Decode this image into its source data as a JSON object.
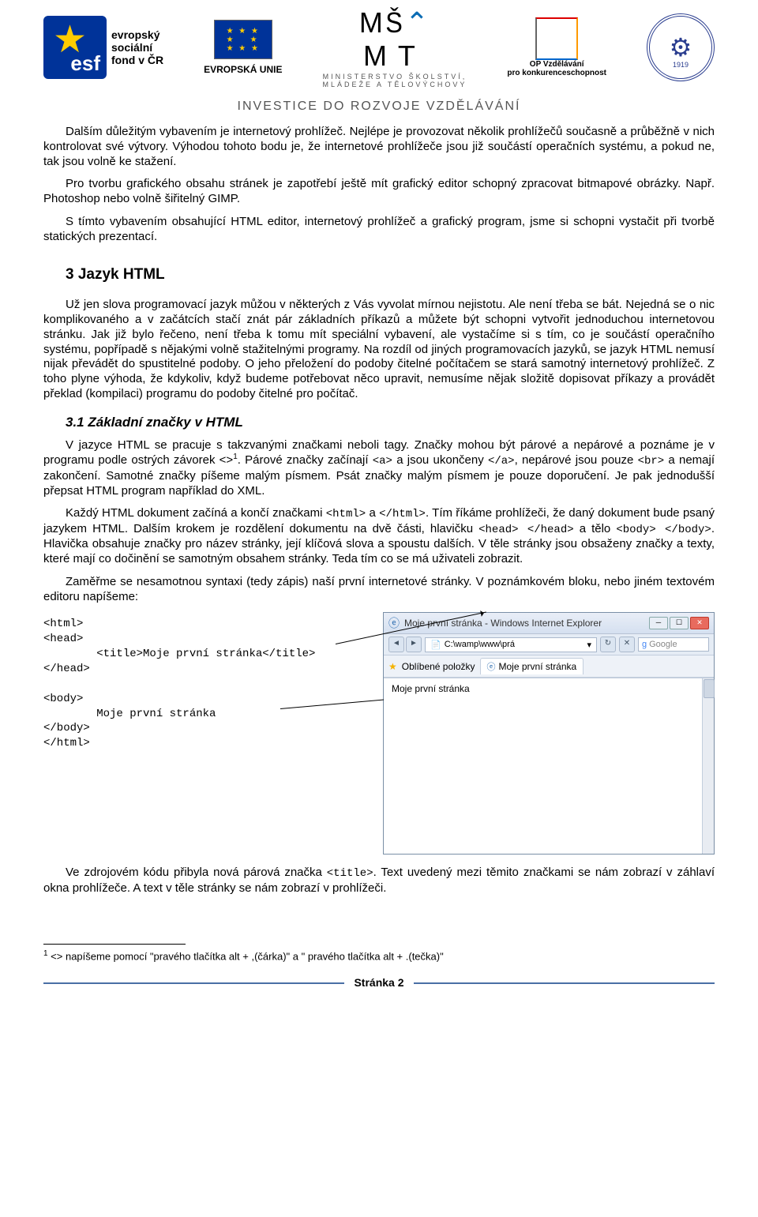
{
  "header": {
    "esf_label_lines": [
      "evropský",
      "sociální",
      "fond v ČR"
    ],
    "eu_label": "EVROPSKÁ UNIE",
    "msmt_top": "MINISTERSTVO ŠKOLSTVÍ,",
    "msmt_bottom": "MLÁDEŽE A TĚLOVÝCHOVY",
    "opvk_line1": "OP Vzdělávání",
    "opvk_line2": "pro konkurenceschopnost",
    "school_year": "1919",
    "invest": "INVESTICE DO ROZVOJE VZDĚLÁVÁNÍ"
  },
  "intro": {
    "p1": "Dalším důležitým vybavením je internetový prohlížeč. Nejlépe je provozovat několik prohlížečů současně a průběžně v nich kontrolovat své výtvory. Výhodou tohoto bodu je, že internetové prohlížeče jsou již součástí operačních systému, a pokud ne, tak jsou volně ke stažení.",
    "p2": "Pro tvorbu grafického obsahu stránek je zapotřebí ještě mít grafický editor schopný zpracovat bitmapové obrázky. Např. Photoshop nebo volně šiřitelný GIMP.",
    "p3": "S tímto vybavením obsahující HTML editor, internetový prohlížeč a grafický program, jsme si schopni vystačit při tvorbě statických prezentací."
  },
  "section3": {
    "heading": "3   Jazyk HTML",
    "p1": "Už jen slova programovací jazyk můžou v některých z Vás vyvolat mírnou nejistotu. Ale není třeba se bát. Nejedná se o nic komplikovaného a v začátcích stačí znát pár základních příkazů a můžete být schopni vytvořit jednoduchou internetovou stránku. Jak již bylo řečeno, není třeba k tomu mít speciální vybavení, ale vystačíme si s tím, co je součástí operačního systému, popřípadě s nějakými volně stažitelnými programy. Na rozdíl od jiných programovacích jazyků, se jazyk HTML nemusí nijak převádět do spustitelné podoby. O jeho přeložení do podoby čitelné počítačem se stará samotný internetový prohlížeč. Z toho plyne výhoda, že kdykoliv, když budeme potřebovat něco upravit, nemusíme nějak složitě dopisovat příkazy a provádět překlad (kompilaci) programu do podoby čitelné pro počítač."
  },
  "section3_1": {
    "heading": "3.1 Základní značky v HTML",
    "p1_a": "V jazyce HTML se pracuje s takzvanými značkami neboli tagy. Značky mohou být párové a nepárové a poznáme je v programu podle ostrých závorek <>",
    "p1_sup": "1",
    "p1_b": ". Párové značky začínají ",
    "p1_code1": "<a>",
    "p1_c": " a jsou ukončeny ",
    "p1_code2": "</a>",
    "p1_d": ", nepárové jsou pouze ",
    "p1_code3": "<br>",
    "p1_e": " a nemají zakončení. Samotné značky píšeme malým písmem. Psát značky malým písmem je pouze doporučení. Je pak jednodušší přepsat HTML program například do XML.",
    "p2_a": "Každý HTML dokument začíná a končí značkami ",
    "p2_code1": "<html>",
    "p2_b": " a ",
    "p2_code2": "</html>",
    "p2_c": ". Tím říkáme prohlížeči, že daný dokument bude psaný jazykem HTML. Dalším krokem je rozdělení dokumentu na dvě části, hlavičku ",
    "p2_code3": "<head> </head>",
    "p2_d": " a tělo ",
    "p2_code4": "<body> </body>",
    "p2_e": ". Hlavička obsahuje značky pro název stránky, její klíčová slova a spoustu dalších. V těle stránky jsou obsaženy značky a texty, které mají co dočinění se samotným obsahem stránky. Teda tím co se má uživateli zobrazit.",
    "p3": "Zaměřme se nesamotnou syntaxi (tedy zápis) naší první internetové stránky. V poznámkovém bloku, nebo jiném textovém editoru napíšeme:"
  },
  "code": {
    "l1": "<html>",
    "l2": "<head>",
    "l3": "        <title>Moje první stránka</title>",
    "l4": "</head>",
    "l5": "",
    "l6": "<body>",
    "l7": "        Moje první stránka",
    "l8": "</body>",
    "l9": "</html>"
  },
  "browser": {
    "title": "Moje první stránka - Windows Internet Explorer",
    "url_icon": "📄",
    "url": "C:\\wamp\\www\\prá",
    "refresh": "↻",
    "stop": "✕",
    "search_label": "Google",
    "fav_label": "Oblíbené položky",
    "tab_label": "Moje první stránka",
    "content": "Moje první stránka"
  },
  "after_code": {
    "p_a": "Ve zdrojovém kódu přibyla nová párová značka ",
    "p_code": "<title>",
    "p_b": ". Text uvedený mezi těmito značkami se nám zobrazí v záhlaví okna prohlížeče. A text v těle stránky se nám zobrazí v prohlížeči."
  },
  "footnote": {
    "num": "1",
    "text": " <> napíšeme pomocí \"pravého tlačítka alt + ,(čárka)\" a \" pravého tlačítka alt + .(tečka)\""
  },
  "footer": {
    "label": "Stránka 2"
  }
}
